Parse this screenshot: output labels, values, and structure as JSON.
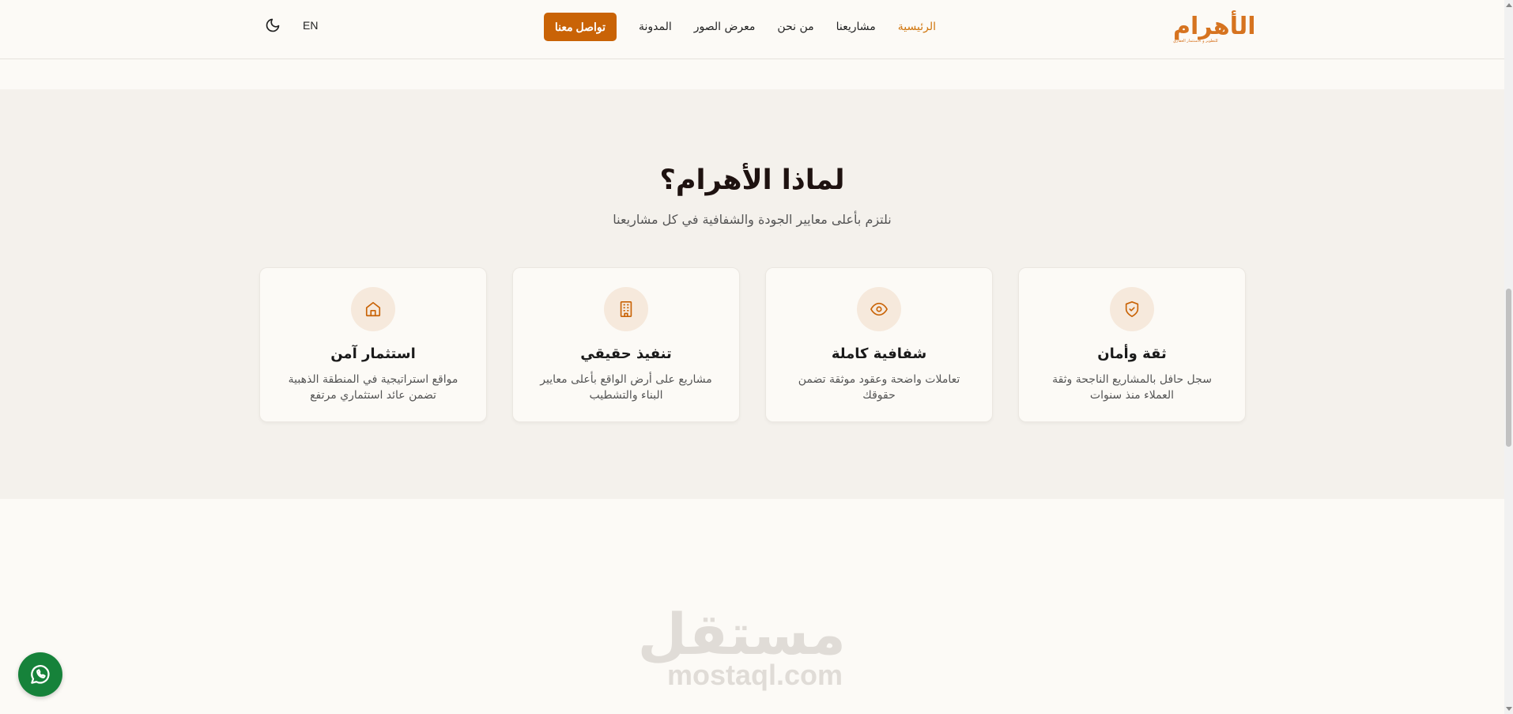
{
  "header": {
    "logo": {
      "mark": "الأهرام",
      "tagline": "للتطوير و الاستثمار العقاري"
    },
    "nav": [
      {
        "label": "الرئيسية",
        "active": true
      },
      {
        "label": "مشاريعنا"
      },
      {
        "label": "من نحن"
      },
      {
        "label": "معرض الصور"
      },
      {
        "label": "المدونة"
      }
    ],
    "contact_label": "تواصل معنا",
    "lang_label": "EN",
    "theme_icon": "moon-icon"
  },
  "why": {
    "title": "لماذا الأهرام؟",
    "subtitle": "نلتزم بأعلى معايير الجودة والشفافية في كل مشاريعنا",
    "cards": [
      {
        "icon": "shield-check-icon",
        "title": "ثقة وأمان",
        "desc": "سجل حافل بالمشاريع الناجحة وثقة العملاء منذ سنوات"
      },
      {
        "icon": "eye-icon",
        "title": "شفافية كاملة",
        "desc": "تعاملات واضحة وعقود موثقة تضمن حقوقك"
      },
      {
        "icon": "building-icon",
        "title": "تنفيذ حقيقي",
        "desc": "مشاريع على أرض الواقع بأعلى معايير البناء والتشطيب"
      },
      {
        "icon": "home-icon",
        "title": "استثمار آمن",
        "desc": "مواقع استراتيجية في المنطقة الذهبية تضمن عائد استثماري مرتفع"
      }
    ]
  },
  "watermark": {
    "ar": "مستقل",
    "en": "mostaql.com"
  },
  "whatsapp": {
    "icon": "whatsapp-icon"
  },
  "colors": {
    "accent": "#c96306",
    "nav_active": "#d0760e",
    "whatsapp": "#16823a",
    "section_bg": "#f4f1ec"
  }
}
